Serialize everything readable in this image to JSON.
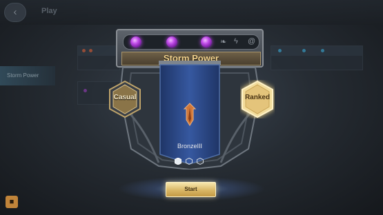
{
  "background": {
    "back_icon": "back-arrow-icon",
    "back_glyph": "‹",
    "play_tab": "Play",
    "side_menu": [
      "Storm Power",
      "",
      ""
    ],
    "profile_icon": "people-icon",
    "profile_glyph": "■"
  },
  "modal": {
    "title": "Storm Power",
    "gems_filled": 3,
    "slot_icons": [
      "feather-icon",
      "lightning-icon",
      "swirl-icon"
    ],
    "slot_glyphs": [
      "❧",
      "ϟ",
      "@"
    ],
    "casual_label": "Casual",
    "ranked_label": "Ranked",
    "rank_name": "BronzeIII",
    "rank_progress": {
      "filled": 1,
      "total": 3
    }
  },
  "start_label": "Start",
  "colors": {
    "gem": "#c04be8",
    "banner": "#2b4a86",
    "gold": "#e4c47b",
    "title": "#f3d38d"
  }
}
